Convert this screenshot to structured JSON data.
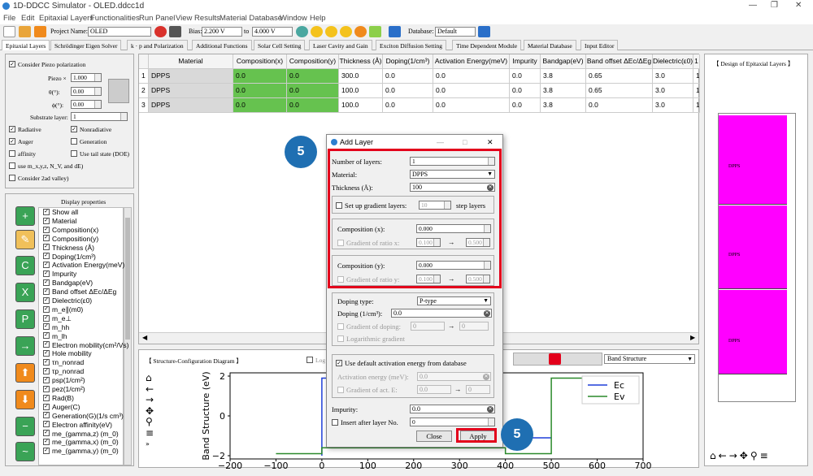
{
  "window": {
    "title": "1D-DDCC Simulator - OLED.ddcc1d",
    "minimize": "—",
    "restore": "❐",
    "close": "✕"
  },
  "menu": [
    "File",
    "Edit",
    "Epitaxial Layers",
    "Functionalities",
    "Run Panel",
    "View Results",
    "Material Database",
    "Window",
    "Help"
  ],
  "toolbar": {
    "project_label": "Project Name:",
    "project_name": "OLED",
    "bias_label": "Bias:",
    "bias_from": "2.200 V",
    "bias_to_label": "to",
    "bias_to": "4.000 V",
    "database_label": "Database:",
    "database": "Default"
  },
  "tabs": [
    "Epitaxial Layers",
    "Schrödinger Eigen Solver",
    "k · p and Polarization",
    "Additional Functions",
    "Solar Cell Setting",
    "Laser Cavity and Gain",
    "Exciton Diffusion Setting",
    "Time Dependent Module",
    "Material Database",
    "Input Editor"
  ],
  "left_panel": {
    "consider_piezo": "Consider Piezo polarization",
    "piezo_x_label": "Piezo ×",
    "piezo_x": "1.000",
    "theta_label": "θ(°):",
    "theta": "0.00",
    "phi_label": "ϕ(°):",
    "phi": "0.00",
    "substrate_label": "Substrate layer:",
    "substrate": "1",
    "radiative": "Radiative",
    "nonradiative": "Nonradiative",
    "auger": "Auger",
    "generation": "Generation",
    "affinity": "affinity",
    "tail_state": "Use tail state (DOE)",
    "use_m": "use m_x,y,z, N_V, and dE)",
    "consider_2ad": "Consider 2ad valley)"
  },
  "display_properties": {
    "title": "Display properties",
    "items": [
      "Show all",
      "Material",
      "Composition(x)",
      "Composition(y)",
      "Thickness (Å)",
      "Doping(1/cm³)",
      "Activation Energy(meV)",
      "Impurity",
      "Bandgap(eV)",
      "Band offset ΔEc/ΔEg",
      "Dielectric(ε0)",
      "m_e∥(m0)",
      "m_e⊥",
      "m_hh",
      "m_lh",
      "Electron mobility(cm²/Vs)",
      "Hole mobility",
      "τn_nonrad",
      "τp_nonrad",
      "psp(1/cm²)",
      "pez(1/cm²)",
      "Rad(B)",
      "Auger(C)",
      "Generation(G)(1/s cm³)",
      "Electron affinity(eV)",
      "me_(gamma,z) (m_0)",
      "me_(gamma,x) (m_0)",
      "me_(gamma,y) (m_0)"
    ],
    "icon_letters": [
      "+",
      "✎",
      "C",
      "X",
      "P",
      "→",
      "⬆",
      "⬇",
      "−",
      "~"
    ]
  },
  "table": {
    "headers": [
      "",
      "Material",
      "Composition(x)",
      "Composition(y)",
      "Thickness (Å)",
      "Doping(1/cm³)",
      "Activation Energy(meV)",
      "Impurity",
      "Bandgap(eV)",
      "Band offset ΔEc/ΔEg",
      "Dielectric(ε0)",
      "1"
    ],
    "rows": [
      [
        "1",
        "DPPS",
        "0.0",
        "0.0",
        "300.0",
        "0.0",
        "0.0",
        "0.0",
        "3.8",
        "0.65",
        "3.0",
        "1"
      ],
      [
        "2",
        "DPPS",
        "0.0",
        "0.0",
        "100.0",
        "0.0",
        "0.0",
        "0.0",
        "3.8",
        "0.65",
        "3.0",
        "1"
      ],
      [
        "3",
        "DPPS",
        "0.0",
        "0.0",
        "100.0",
        "0.0",
        "0.0",
        "0.0",
        "3.8",
        "0.0",
        "3.0",
        "1"
      ]
    ]
  },
  "structure_diagram": {
    "title": "【 Structure-Configuration Diagram 】",
    "log_label": "Log",
    "band_select": "Band Structure"
  },
  "design_panel": {
    "title": "【 Design of Epitaxial Layers 】",
    "layers": [
      "DPPS",
      "DPPS",
      "DPPS"
    ],
    "layer_color": "#ff00ff"
  },
  "chart_data": {
    "type": "line",
    "ylabel": "Band Structure (eV)",
    "xlim": [
      -200,
      700
    ],
    "ylim": [
      -2,
      2
    ],
    "xticks": [
      "−200",
      "−100",
      "0",
      "100",
      "200",
      "300",
      "400",
      "500",
      "600",
      "700"
    ],
    "yticks": [
      "2",
      "0",
      "−2"
    ],
    "series": [
      {
        "name": "Ec",
        "color": "#1f3fd8",
        "x": [
          0,
          0,
          300,
          300,
          500
        ],
        "y": [
          -2,
          1.9,
          1.9,
          -1.1,
          -1.1
        ]
      },
      {
        "name": "Ev",
        "color": "#2a8a2a",
        "x": [
          -100,
          0,
          0,
          400,
          400,
          500,
          500,
          600
        ],
        "y": [
          -1.9,
          -1.9,
          -1.6,
          -1.6,
          -1.9,
          -1.9,
          1.9,
          1.9
        ]
      }
    ]
  },
  "dialog": {
    "title": "Add Layer",
    "num_layers_label": "Number of layers:",
    "num_layers": "1",
    "material_label": "Material:",
    "material": "DPPS",
    "thickness_label": "Thickness (Å):",
    "thickness": "100",
    "gradient_label": "Set up gradient layers:",
    "gradient_steps": "10",
    "gradient_unit": "step layers",
    "comp_x_label": "Composition (x):",
    "comp_x": "0.000",
    "grad_x_label": "Gradient of ratio x:",
    "grad_x_from": "0.100",
    "grad_x_to": "0.500",
    "comp_y_label": "Composition (y):",
    "comp_y": "0.000",
    "grad_y_label": "Gradient of ratio y:",
    "grad_y_from": "0.100",
    "grad_y_to": "0.500",
    "doping_type_label": "Doping type:",
    "doping_type": "P-type",
    "doping_label": "Doping (1/cm³):",
    "doping": "0.0",
    "grad_doping_label": "Gradient of doping:",
    "grad_doping_from": "0",
    "grad_doping_to": "0",
    "log_gradient": "Logarithmic gradient",
    "default_activation": "Use default activation energy from database",
    "activation_label": "Activation energy (meV):",
    "activation": "0.0",
    "grad_act_label": "Gradient of act. E:",
    "grad_act_from": "0.0",
    "grad_act_to": "0",
    "impurity_label": "Impurity:",
    "impurity": "0.0",
    "insert_after": "Insert after layer No.",
    "insert_no": "0",
    "close": "Close",
    "apply": "Apply",
    "arrow": "→"
  },
  "badges": {
    "top": "5",
    "bottom": "5"
  }
}
